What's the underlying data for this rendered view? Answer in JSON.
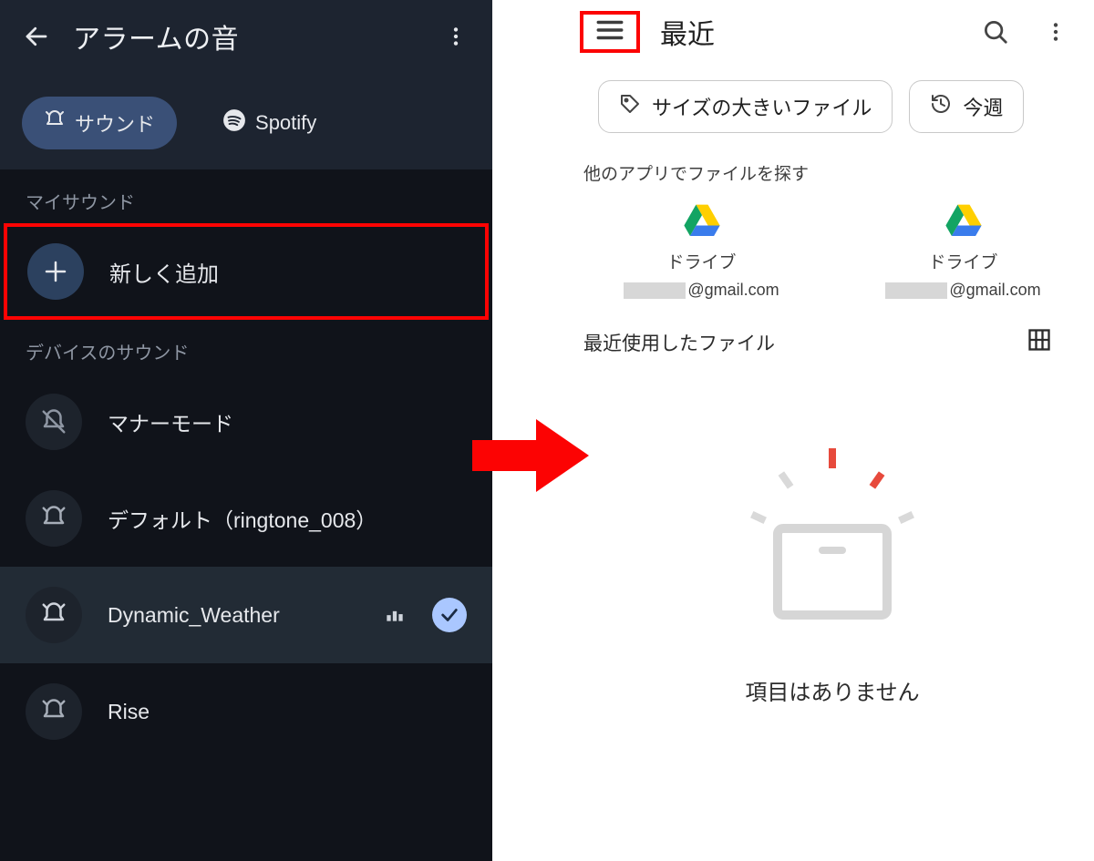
{
  "left": {
    "title": "アラームの音",
    "tabs": {
      "sound": "サウンド",
      "spotify": "Spotify"
    },
    "section_my": "マイサウンド",
    "add_label": "新しく追加",
    "section_device": "デバイスのサウンド",
    "items": [
      {
        "label": "マナーモード"
      },
      {
        "label": "デフォルト（ringtone_008）"
      },
      {
        "label": "Dynamic_Weather"
      },
      {
        "label": "Rise"
      }
    ]
  },
  "right": {
    "title": "最近",
    "chips": {
      "large": "サイズの大きいファイル",
      "week": "今週"
    },
    "other_apps": "他のアプリでファイルを探す",
    "drive_label": "ドライブ",
    "drive_email_suffix": "@gmail.com",
    "recent_files": "最近使用したファイル",
    "empty": "項目はありません"
  }
}
